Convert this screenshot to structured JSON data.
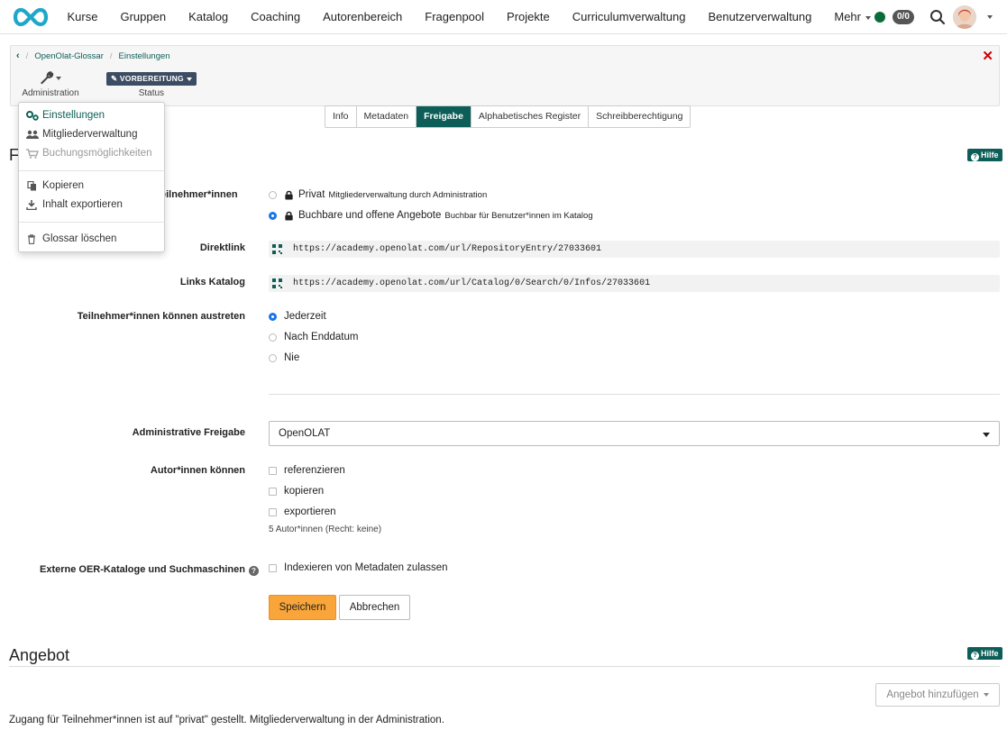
{
  "nav": {
    "items": [
      "Kurse",
      "Gruppen",
      "Katalog",
      "Coaching",
      "Autorenbereich",
      "Fragenpool",
      "Projekte",
      "Curriculumverwaltung",
      "Benutzerverwaltung",
      "Mehr"
    ],
    "badge": "0/0"
  },
  "breadcrumb": {
    "items": [
      "OpenOlat-Glossar",
      "Einstellungen"
    ]
  },
  "toolbar": {
    "admin_label": "Administration",
    "status_value": "VORBEREITUNG",
    "status_label": "Status"
  },
  "tabs": [
    "Info",
    "Metadaten",
    "Freigabe",
    "Alphabetisches Register",
    "Schreibberechtigung"
  ],
  "active_tab": "Freigabe",
  "help_label": "Hilfe",
  "section_title_partial": "F",
  "form": {
    "access_label_partial": "eilnehmer*innen",
    "access_options": [
      {
        "label": "Privat",
        "sub": "Mitgliederverwaltung durch Administration",
        "selected": false
      },
      {
        "label": "Buchbare und offene Angebote",
        "sub": "Buchbar für Benutzer*innen im Katalog",
        "selected": true
      }
    ],
    "direktlink_label": "Direktlink",
    "direktlink_value": "https://academy.openolat.com/url/RepositoryEntry/27033601",
    "links_katalog_label": "Links Katalog",
    "links_katalog_value": "https://academy.openolat.com/url/Catalog/0/Search/0/Infos/27033601",
    "leave_label": "Teilnehmer*innen können austreten",
    "leave_options": [
      {
        "label": "Jederzeit",
        "selected": true
      },
      {
        "label": "Nach Enddatum",
        "selected": false
      },
      {
        "label": "Nie",
        "selected": false
      }
    ],
    "admin_release_label": "Administrative Freigabe",
    "admin_release_value": "OpenOLAT",
    "authors_label": "Autor*innen können",
    "authors_options": [
      {
        "label": "referenzieren",
        "checked": false
      },
      {
        "label": "kopieren",
        "checked": false
      },
      {
        "label": "exportieren",
        "checked": false
      }
    ],
    "authors_note": "5 Autor*innen (Recht: keine)",
    "oer_label": "Externe OER-Kataloge und Suchmaschinen",
    "oer_option": "Indexieren von Metadaten zulassen",
    "save_label": "Speichern",
    "cancel_label": "Abbrechen"
  },
  "angebot": {
    "title": "Angebot",
    "add_button": "Angebot hinzufügen",
    "info_text": "Zugang für Teilnehmer*innen ist auf \"privat\" gestellt. Mitgliederverwaltung in der Administration."
  },
  "admin_menu": {
    "items": [
      "Einstellungen",
      "Mitgliederverwaltung",
      "Buchungsmöglichkeiten",
      "Kopieren",
      "Inhalt exportieren",
      "Glossar löschen"
    ]
  },
  "colors": {
    "accent": "#0d5e58",
    "save": "#f9a53a",
    "status": "#3b4c63",
    "close": "#cc0000"
  }
}
